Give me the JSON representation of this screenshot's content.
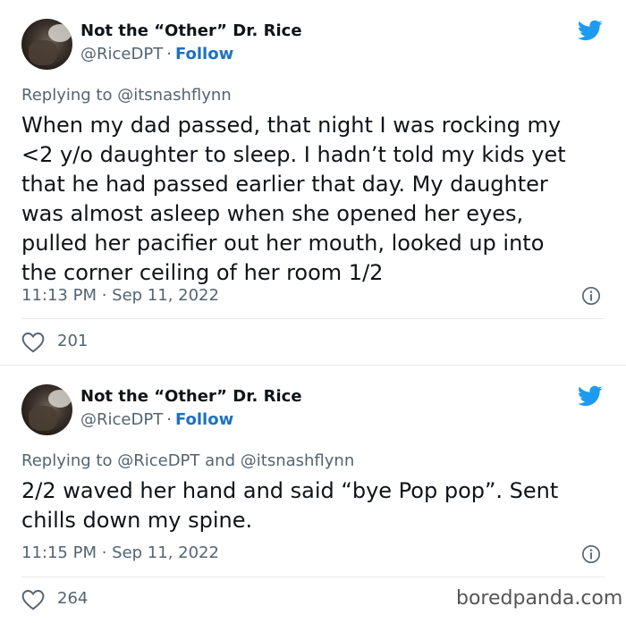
{
  "tweets": [
    {
      "author_name": "Not the “Other” Dr. Rice",
      "handle": "@RiceDPT",
      "separator": "·",
      "follow_label": "Follow",
      "reply_prefix": "Replying to",
      "reply_mention_1": "@itsnashflynn",
      "lines": [
        "When my dad passed, that night I was rocking my",
        "<2 y/o daughter to sleep. I hadn’t told my kids yet",
        "that he had passed earlier that day. My daughter",
        "was almost asleep when she opened her eyes,",
        "pulled her pacifier out her mouth, looked up into",
        "the corner ceiling of her room 1/2"
      ],
      "timestamp": "11:13 PM · Sep 11, 2022",
      "likes": "201"
    },
    {
      "author_name": "Not the “Other” Dr. Rice",
      "handle": "@RiceDPT",
      "separator": "·",
      "follow_label": "Follow",
      "reply_prefix": "Replying to",
      "reply_mention_1": "@RiceDPT",
      "reply_and": "and",
      "reply_mention_2": "@itsnashflynn",
      "lines": [
        "2/2 waved her hand and said “bye Pop pop”. Sent",
        "chills down my spine."
      ],
      "timestamp": "11:15 PM · Sep 11, 2022",
      "likes": "264"
    }
  ],
  "watermark": "boredpanda.com",
  "colors": {
    "twitter_blue": "#1d9bf0",
    "follow_blue": "#1d72c2",
    "muted": "#536471",
    "text": "#0f1419"
  },
  "icons": {
    "logo": "twitter-bird-icon",
    "info": "info-icon",
    "like": "heart-icon"
  }
}
